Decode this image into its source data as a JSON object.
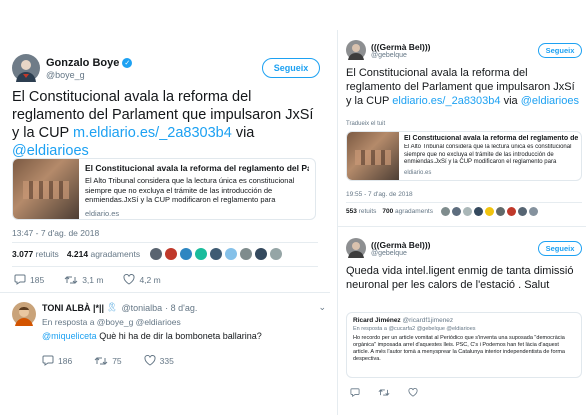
{
  "left": {
    "tweet": {
      "author_name": "Gonzalo Boye",
      "author_handle": "@boye_g",
      "verified_badge": "✓",
      "follow_label": "Segueix",
      "text_before": "El Constitucional avala la reforma del reglamento del Parlament que impulsaron JxSí y la CUP",
      "link": "m.eldiario.es/_2a8303b4",
      "text_via": "via",
      "mention": "@eldiarioes",
      "card": {
        "title": "El Constitucional avala la reforma del reglamento del Parla...",
        "description": "El Alto Tribunal considera que la lectura única es constitucional siempre que no excluya el trámite de las introducción de enmiendas.JxSí y la CUP modificaron el reglamento para",
        "domain": "eldiario.es"
      },
      "timestamp": "13:47 - 7 d'ag. de 2018",
      "retweets_count": "3.077",
      "retweets_label": "retuits",
      "likes_count": "4.214",
      "likes_label": "agradaments",
      "actions": {
        "reply_count": "185",
        "retweet_count": "3,1 m",
        "like_count": "4,2 m"
      }
    },
    "reply": {
      "author_name": "TONI ALBÀ |*||",
      "author_handle": "@tonialba",
      "time": "· 8 d'ag.",
      "in_reply_to": "En resposta a @boye_g @eldiarioes",
      "mention": "@miqueliceta",
      "text": "Què hi ha de dir la bomboneta ballarina?",
      "actions": {
        "reply_count": "186",
        "retweet_count": "75",
        "like_count": "335"
      }
    }
  },
  "right": {
    "tweet1": {
      "author_name": "(((Germà Bel)))",
      "author_handle": "@gebelque",
      "follow_label": "Segueix",
      "text": "El Constitucional avala la reforma del reglamento del Parlament que impulsaron JxSí y la CUP",
      "link": "eldiario.es/_2a8303b4",
      "text_via": "via",
      "mention": "@eldiarioes",
      "translate": "Tradueix el tuit",
      "card": {
        "title": "El Constitucional avala la reforma del reglamento del Parla...",
        "description": "El Alto Tribunal considera que la lectura única es constitucional siempre que no excluya el trámite de las introducción de enmiendas.JxSí y la CUP modificaron el reglamento para",
        "domain": "eldiario.es"
      },
      "timestamp": "19:55 - 7 d'ag. de 2018",
      "retweets_count": "553",
      "retweets_label": "retuits",
      "likes_count": "700",
      "likes_label": "agradaments"
    },
    "tweet2": {
      "author_name": "(((Germà Bel)))",
      "author_handle": "@gebelque",
      "follow_label": "Segueix",
      "text": "Queda vida intel.ligent enmig de tanta dimissió neuronal per les calors de l'estació . Salut",
      "quote": {
        "author_name": "Ricard Jiménez",
        "author_handle": "@ricardf1jimenez",
        "in_reply_to": "En resposta a @cucarfa2 @gebelque @eldiarioes",
        "text": "Ho recordo per un article vomitat al Periódico que s'inventa una suposada \"democràcia orgànica\" imposada arrel d'aquestes lleis. PSC, C's i Podemos han fet làcia d'aquest article. A més l'autor tomà a menysprear la Catalunya interior independentista de forma despectiva."
      }
    }
  }
}
